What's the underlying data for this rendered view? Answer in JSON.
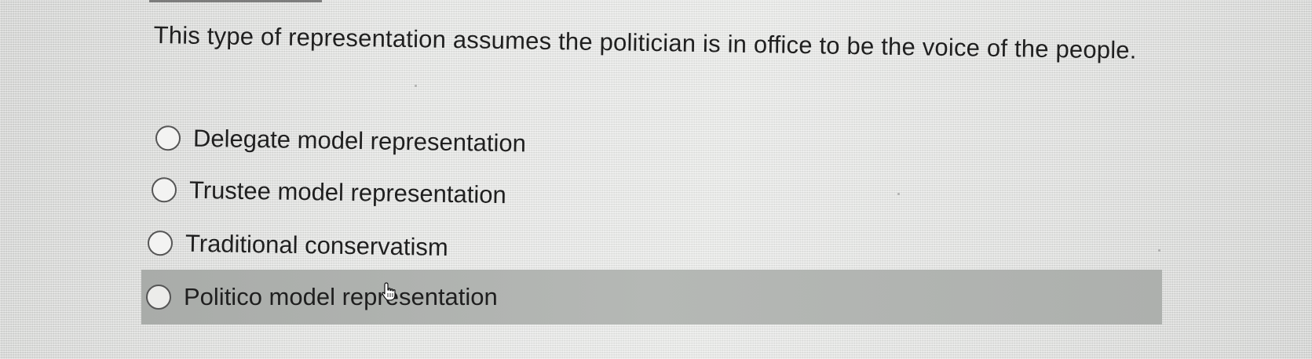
{
  "question": {
    "text": "This type of representation assumes the politician is in office to be the voice of the people."
  },
  "options": [
    {
      "label": "Delegate model representation",
      "selected": false
    },
    {
      "label": "Trustee model representation",
      "selected": false
    },
    {
      "label": "Traditional conservatism",
      "selected": false
    },
    {
      "label": "Politico model representation",
      "selected": false,
      "hovered": true
    }
  ],
  "cursor": {
    "icon": "hand-pointer-icon"
  },
  "colors": {
    "background": "#e2e3e1",
    "hover_highlight": "#b3b6b3",
    "text": "#1f1f1f"
  }
}
